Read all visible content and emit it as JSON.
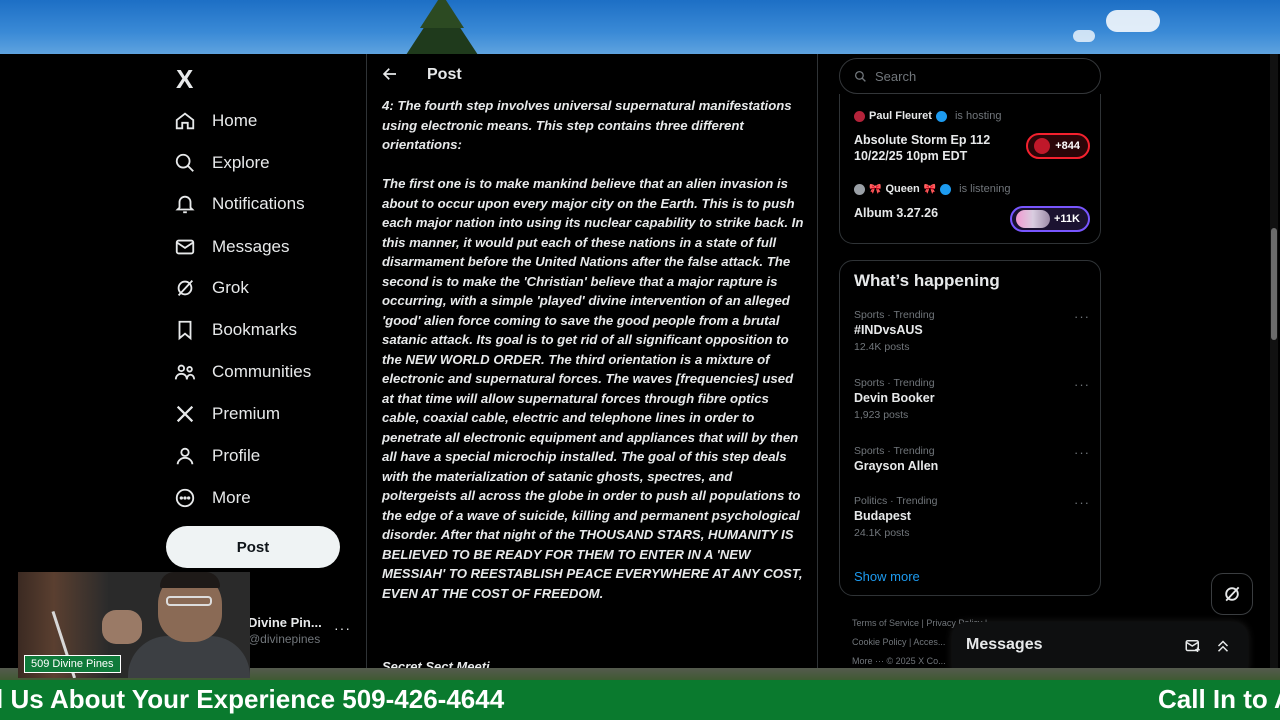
{
  "app": {
    "logo": "X"
  },
  "nav": {
    "items": [
      {
        "label": "Home",
        "icon": "home-icon"
      },
      {
        "label": "Explore",
        "icon": "search-icon"
      },
      {
        "label": "Notifications",
        "icon": "bell-icon"
      },
      {
        "label": "Messages",
        "icon": "envelope-icon"
      },
      {
        "label": "Grok",
        "icon": "grok-icon"
      },
      {
        "label": "Bookmarks",
        "icon": "bookmark-icon"
      },
      {
        "label": "Communities",
        "icon": "communities-icon"
      },
      {
        "label": "Premium",
        "icon": "x-icon"
      },
      {
        "label": "Profile",
        "icon": "person-icon"
      },
      {
        "label": "More",
        "icon": "more-circle-icon"
      }
    ],
    "post_button": "Post",
    "account": {
      "name": "Divine Pin...",
      "handle": "@divinepines",
      "more": "···"
    }
  },
  "post": {
    "header_title": "Post",
    "paragraphs": [
      "4: The fourth step involves universal supernatural manifestations using electronic means. This step contains three different orientations:",
      "The first one is to make mankind believe that an alien invasion is about to occur upon every major city on the Earth. This is to push each major nation into using its nuclear capability to strike back. In this manner, it would put each of these nations in a state of full disarmament before the United Nations after the false attack. The second is to make the 'Christian' believe that a major rapture is occurring, with a simple 'played' divine intervention of an alleged 'good' alien force coming to save the good people from a brutal satanic attack. Its goal is to get rid of all significant opposition to the NEW WORLD ORDER. The third orientation is a mixture of electronic and supernatural forces. The waves [frequencies] used at that time will allow supernatural forces through fibre optics cable, coaxial cable, electric and telephone lines in order to penetrate all electronic equipment and appliances that will by then all have a special microchip installed. The goal of this step deals with the materialization of satanic ghosts, spectres, and poltergeists all across the globe in order to push all populations to the edge of a wave of suicide, killing and permanent psychological disorder. After that night of the THOUSAND STARS, HUMANITY IS BELIEVED TO BE READY FOR THEM TO ENTER IN A 'NEW MESSIAH' TO REESTABLISH PEACE EVERYWHERE AT ANY COST, EVEN AT THE COST OF FREEDOM."
    ],
    "cut_off_text": "Secret Sect Meeti..."
  },
  "search": {
    "placeholder": "Search"
  },
  "spaces": [
    {
      "host": "Paul Fleuret",
      "status": "is hosting",
      "title_line1": "Absolute Storm Ep 112",
      "title_line2": "10/22/25 10pm EDT",
      "listeners": "+844"
    },
    {
      "host": "Queen",
      "status": "is listening",
      "title_line1": "Album 3.27.26",
      "title_line2": "",
      "listeners": "+11K"
    }
  ],
  "happening": {
    "title": "What’s happening",
    "trends": [
      {
        "meta": "Sports · Trending",
        "name": "#INDvsAUS",
        "count": "12.4K posts"
      },
      {
        "meta": "Sports · Trending",
        "name": "Devin Booker",
        "count": "1,923 posts"
      },
      {
        "meta": "Sports · Trending",
        "name": "Grayson Allen",
        "count": ""
      },
      {
        "meta": "Politics · Trending",
        "name": "Budapest",
        "count": "24.1K posts"
      }
    ],
    "show_more": "Show more"
  },
  "footer": {
    "line1": "Terms of Service  |  Privacy Policy  |",
    "line2": "Cookie Policy  |  Acces...",
    "line3": "More ···  © 2025 X Co..."
  },
  "messages_drawer": {
    "title": "Messages"
  },
  "overlay": {
    "cam_label": "509 Divine Pines",
    "ticker_left": "l Us About Your Experience 509-426-4644",
    "ticker_right": "Call In to A"
  },
  "colors": {
    "accent": "#1d9bf0",
    "ticker_bg": "#0a7a2e",
    "live_red": "#f4212e",
    "live_purple": "#7856ff"
  }
}
